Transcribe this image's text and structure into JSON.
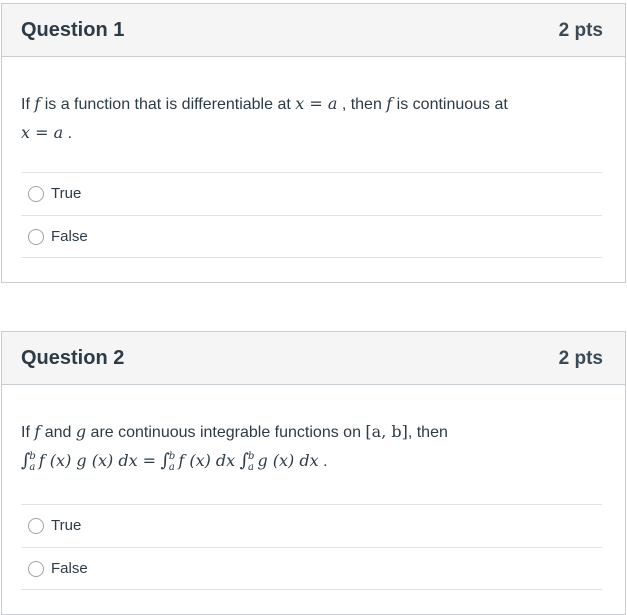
{
  "questions": [
    {
      "title": "Question 1",
      "points": "2 pts",
      "text": {
        "p1": "If ",
        "f1": "f",
        "p2": " is a function that is differentiable at ",
        "m1": "x = a",
        "p3": " , then ",
        "f2": "f",
        "p4": " is continuous at",
        "m2": "x = a",
        "p5": " ."
      },
      "answers": [
        "True",
        "False"
      ]
    },
    {
      "title": "Question 2",
      "points": "2 pts",
      "text": {
        "p1": "If ",
        "f": "f",
        "p2": " and ",
        "g": "g",
        "p3": " are continuous integrable functions on ",
        "interval": "[a, b]",
        "p4": ", then",
        "formula_lhs": "f (x) g (x) dx =",
        "formula_r1": "f (x) dx",
        "formula_r2": "g (x) dx",
        "end": " .",
        "lower": "a",
        "upper": "b"
      },
      "answers": [
        "True",
        "False"
      ]
    }
  ]
}
